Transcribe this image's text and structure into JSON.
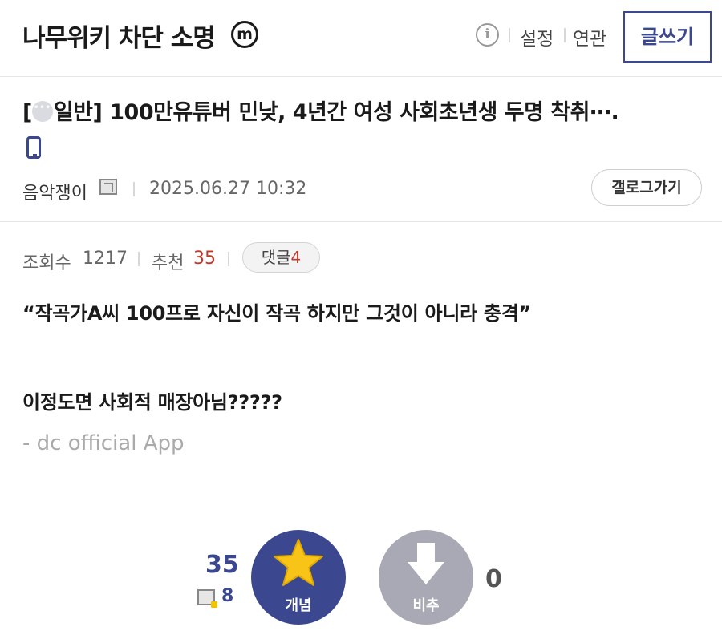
{
  "header": {
    "gallery_title": "나무위키 차단 소명",
    "minor_badge": "m",
    "info_icon": "info-icon",
    "settings_label": "설정",
    "related_label": "연관",
    "write_label": "글쓰기"
  },
  "post": {
    "category": "[",
    "category_icon": "chat-bubble-icon",
    "title": "일반] 100만유튜버 민낮, 4년간 여성 사회초년생 두명 착취⋯.",
    "device_icon": "mobile-icon",
    "author": "음악쟁이",
    "date": "2025.06.27 10:32",
    "gallery_button": "갤로그가기"
  },
  "stats": {
    "views_label": "조회수",
    "views_value": "1217",
    "recommend_label": "추천",
    "recommend_value": "35",
    "comments_label": "댓글",
    "comments_value": "4"
  },
  "body": {
    "line1": "“작곡가A씨 100프로 자신이 작곡 하지만 그것이 아니라 충격”",
    "line2": "이정도면 사회적 매장아님?????",
    "signature": "- dc official App"
  },
  "votes": {
    "up_count": "35",
    "fixed_count": "8",
    "up_label": "개념",
    "down_label": "비추",
    "down_count": "0"
  },
  "colors": {
    "accent": "#3b4890",
    "recommend_red": "#c0392b",
    "downvote_gray": "#a8a9b4",
    "star_yellow": "#f7c417"
  }
}
